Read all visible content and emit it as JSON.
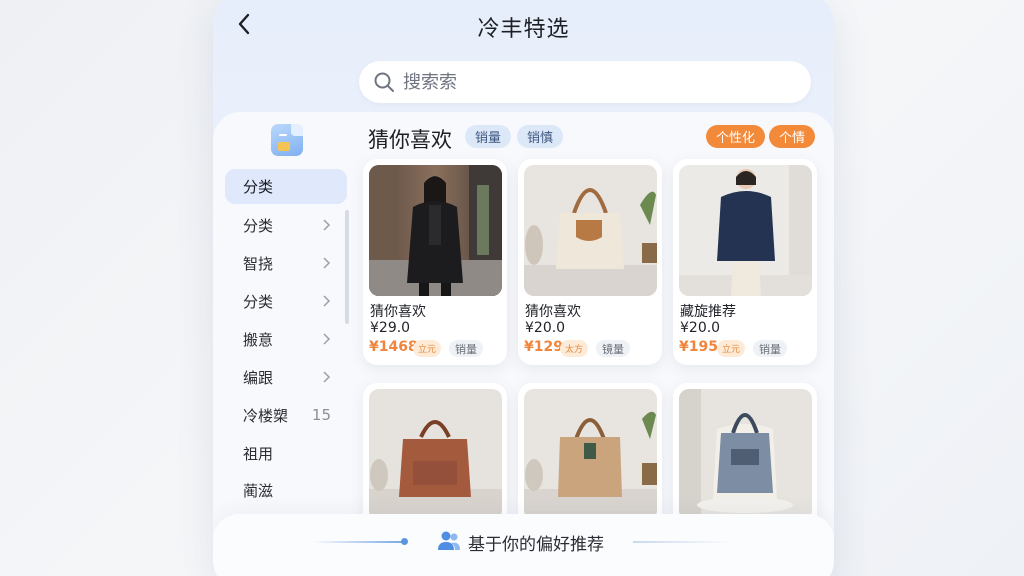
{
  "header": {
    "title": "冷丰特选"
  },
  "search": {
    "placeholder": "搜索索",
    "value": ""
  },
  "section": {
    "title": "猜你喜欢",
    "chips_left": [
      "销量",
      "销慎"
    ],
    "chips_right": [
      "个性化",
      "个情"
    ]
  },
  "sidebar": {
    "items": [
      {
        "label": "分类",
        "active": true,
        "chevron": false
      },
      {
        "label": "分类",
        "chevron": true
      },
      {
        "label": "智挠",
        "chevron": true
      },
      {
        "label": "分类",
        "chevron": true
      },
      {
        "label": "搬意",
        "chevron": true
      },
      {
        "label": "编跟",
        "chevron": true
      },
      {
        "label": "冷楼槊",
        "count": "15"
      },
      {
        "label": "祖用"
      },
      {
        "label": "蔺滋"
      }
    ]
  },
  "products": [
    {
      "name": "猜你喜欢",
      "price": "¥29.0",
      "sale": "¥1468",
      "tag": "立元",
      "tag2": "销量",
      "image": "woman-black-coat"
    },
    {
      "name": "猜你喜欢",
      "price": "¥20.0",
      "sale": "¥129",
      "tag": "太方",
      "tag2": "镜量",
      "image": "cream-tote-bag"
    },
    {
      "name": "藏旋推荐",
      "price": "¥20.0",
      "sale": "¥195",
      "tag": "立元",
      "tag2": "销量",
      "image": "woman-navy-jacket"
    },
    {
      "image": "brown-leather-bag"
    },
    {
      "image": "tan-tote-bag"
    },
    {
      "image": "grey-canvas-bag"
    }
  ],
  "bottom": {
    "text": "基于你的偏好推荐"
  },
  "colors": {
    "accent_orange": "#f28a3a",
    "chip_blue": "#dce7f8",
    "active_bg": "#dfe9fb"
  }
}
